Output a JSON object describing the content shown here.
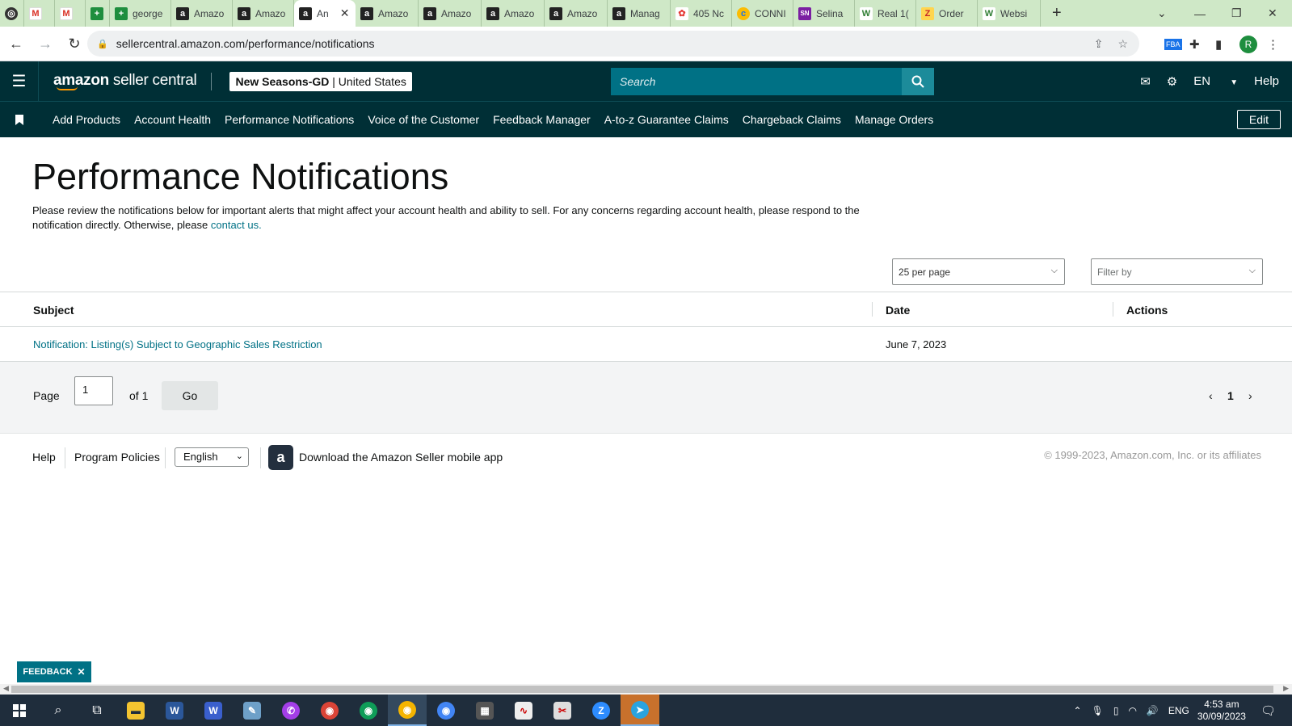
{
  "browser": {
    "tabs": [
      {
        "label": "",
        "icon": "chrome-logo-icon"
      },
      {
        "label": "",
        "icon": "gmail-icon"
      },
      {
        "label": "",
        "icon": "gmail-icon"
      },
      {
        "label": "",
        "icon": "sheets-icon"
      },
      {
        "label": "george",
        "icon": "sheets-icon"
      },
      {
        "label": "Amazo",
        "icon": "amazon-icon"
      },
      {
        "label": "Amazo",
        "icon": "amazon-icon"
      },
      {
        "label": "An",
        "icon": "amazon-icon",
        "active": true
      },
      {
        "label": "Amazo",
        "icon": "amazon-icon"
      },
      {
        "label": "Amazo",
        "icon": "amazon-icon"
      },
      {
        "label": "Amazo",
        "icon": "amazon-icon"
      },
      {
        "label": "Amazo",
        "icon": "amazon-icon"
      },
      {
        "label": "Manag",
        "icon": "amazon-icon"
      },
      {
        "label": "405 Nc",
        "icon": "fruit-icon"
      },
      {
        "label": "CONNI",
        "icon": "connect-icon"
      },
      {
        "label": "Selina",
        "icon": "sn-icon"
      },
      {
        "label": "Real 1(",
        "icon": "w-icon"
      },
      {
        "label": "Order",
        "icon": "order-icon"
      },
      {
        "label": "Websi",
        "icon": "w-icon"
      }
    ],
    "url": "sellercentral.amazon.com/performance/notifications",
    "profile_initial": "R"
  },
  "header": {
    "logo_prefix": "amazon",
    "logo_suffix": " seller central",
    "store_name": "New Seasons-GD",
    "store_region": " | United States",
    "search_placeholder": "Search",
    "language": "EN",
    "help": "Help"
  },
  "nav": {
    "links": [
      "Add Products",
      "Account Health",
      "Performance Notifications",
      "Voice of the Customer",
      "Feedback Manager",
      "A-to-z Guarantee Claims",
      "Chargeback Claims",
      "Manage Orders"
    ],
    "edit": "Edit"
  },
  "main": {
    "title": "Performance Notifications",
    "intro": "Please review the notifications below for important alerts that might affect your account health and ability to sell. For any concerns regarding account health, please respond to the notification directly. Otherwise, please ",
    "contact_link": "contact us.",
    "per_page": "25 per page",
    "filter_placeholder": "Filter by"
  },
  "table": {
    "headers": {
      "subject": "Subject",
      "date": "Date",
      "actions": "Actions"
    },
    "rows": [
      {
        "subject": "Notification: Listing(s) Subject to Geographic Sales Restriction",
        "date": "June 7, 2023",
        "actions": ""
      }
    ]
  },
  "pager": {
    "page_label": "Page",
    "page_value": "1",
    "of_label": "of 1",
    "go": "Go",
    "current": "1"
  },
  "footer": {
    "help": "Help",
    "policies": "Program Policies",
    "language": "English",
    "app_link": "Download the Amazon Seller mobile app",
    "copyright": "© 1999-2023, Amazon.com, Inc. or its affiliates"
  },
  "feedback": "FEEDBACK",
  "taskbar": {
    "language": "ENG",
    "time": "4:53 am",
    "date": "30/09/2023"
  },
  "colors": {
    "header_bg": "#002f36",
    "link": "#007185",
    "accent": "#ff9900",
    "tabstrip": "#cfe8c7"
  }
}
